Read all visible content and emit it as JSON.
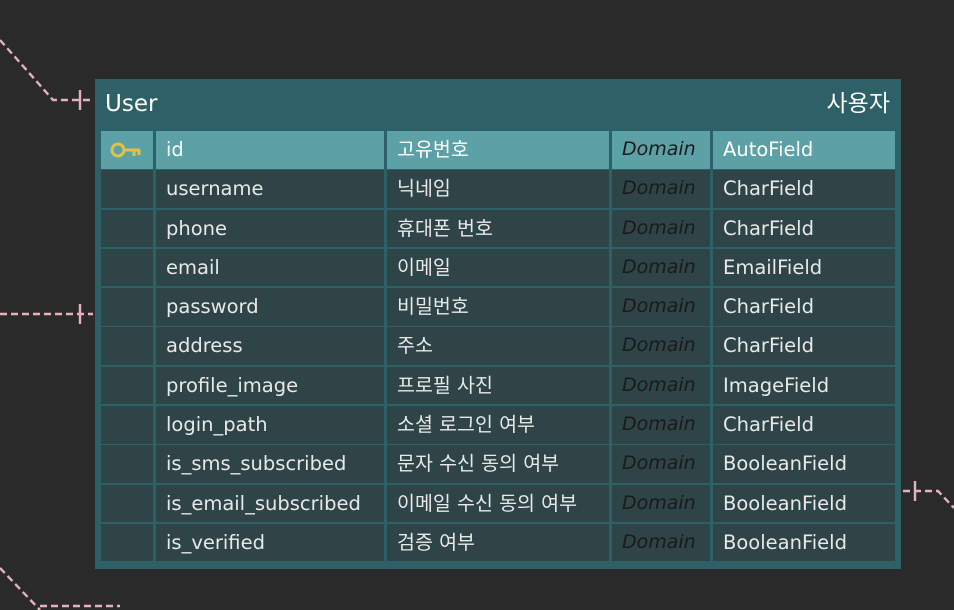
{
  "entity": {
    "name": "User",
    "logical_name": "사용자",
    "columns": [
      {
        "name": "id",
        "logical": "고유번호",
        "domain": "Domain",
        "type": "AutoField",
        "primary_key": true
      },
      {
        "name": "username",
        "logical": "닉네임",
        "domain": "Domain",
        "type": "CharField",
        "primary_key": false
      },
      {
        "name": "phone",
        "logical": "휴대폰 번호",
        "domain": "Domain",
        "type": "CharField",
        "primary_key": false
      },
      {
        "name": "email",
        "logical": "이메일",
        "domain": "Domain",
        "type": "EmailField",
        "primary_key": false
      },
      {
        "name": "password",
        "logical": "비밀번호",
        "domain": "Domain",
        "type": "CharField",
        "primary_key": false
      },
      {
        "name": "address",
        "logical": "주소",
        "domain": "Domain",
        "type": "CharField",
        "primary_key": false
      },
      {
        "name": "profile_image",
        "logical": "프로필 사진",
        "domain": "Domain",
        "type": "ImageField",
        "primary_key": false
      },
      {
        "name": "login_path",
        "logical": "소셜 로그인 여부",
        "domain": "Domain",
        "type": "CharField",
        "primary_key": false
      },
      {
        "name": "is_sms_subscribed",
        "logical": "문자 수신 동의 여부",
        "domain": "Domain",
        "type": "BooleanField",
        "primary_key": false
      },
      {
        "name": "is_email_subscribed",
        "logical": "이메일 수신 동의 여부",
        "domain": "Domain",
        "type": "BooleanField",
        "primary_key": false
      },
      {
        "name": "is_verified",
        "logical": "검증 여부",
        "domain": "Domain",
        "type": "BooleanField",
        "primary_key": false
      }
    ]
  },
  "icons": {
    "primary_key": "key-icon"
  },
  "colors": {
    "background": "#2a2a2a",
    "entity_fill": "#2d6167",
    "cell_fill": "#2e4447",
    "primary_key_fill": "#5ba1a6",
    "relation_line": "#e8b0b8",
    "key_icon": "#e0c24a"
  }
}
